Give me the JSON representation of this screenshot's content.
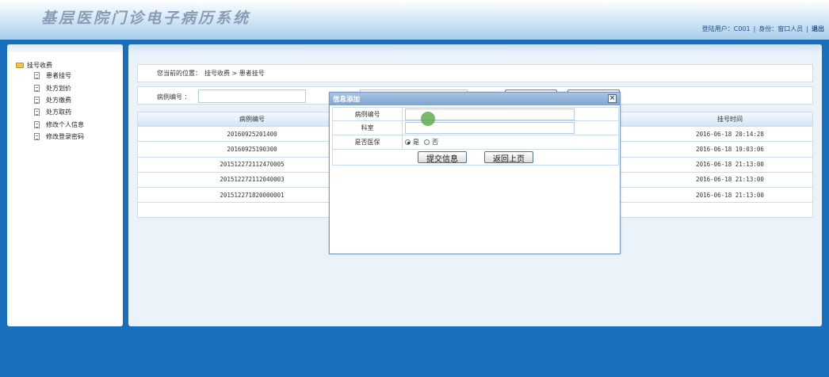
{
  "header": {
    "title": "基层医院门诊电子病历系统",
    "user_label": "登陆用户：C001",
    "role_label": "身份：窗口人员",
    "logout": "退出"
  },
  "sidebar": {
    "group": "挂号收费",
    "items": [
      {
        "label": "患者挂号"
      },
      {
        "label": "处方划价"
      },
      {
        "label": "处方缴费"
      },
      {
        "label": "处方取药"
      },
      {
        "label": "修改个人信息"
      },
      {
        "label": "修改登录密码"
      }
    ]
  },
  "breadcrumb": {
    "prefix": "您当前的位置：",
    "path": "挂号收费 > 患者挂号"
  },
  "search": {
    "label": "病例编号 ：",
    "value": ""
  },
  "table": {
    "headers": [
      "病例编号",
      "",
      "挂号时间"
    ],
    "rows": [
      {
        "id": "20160925201400",
        "mid": "",
        "time": "2016-06-18 20:14:28"
      },
      {
        "id": "20160925190300",
        "mid": "",
        "time": "2016-06-18 19:03:06"
      },
      {
        "id": "201512272112470005",
        "mid": "",
        "time": "2016-06-18 21:13:00"
      },
      {
        "id": "201512272112040003",
        "mid": "",
        "time": "2016-06-18 21:13:00"
      },
      {
        "id": "201512271820000001",
        "mid": "",
        "time": "2016-06-18 21:13:00"
      }
    ]
  },
  "dialog": {
    "title": "信息添加",
    "close": "×",
    "fields": {
      "case_no_label": "病例编号",
      "case_no_value": "",
      "dept_label": "科室",
      "dept_value": "",
      "insurance_label": "是否医保",
      "yes": "是",
      "no": "否"
    },
    "submit": "提交信息",
    "back": "返回上页"
  }
}
